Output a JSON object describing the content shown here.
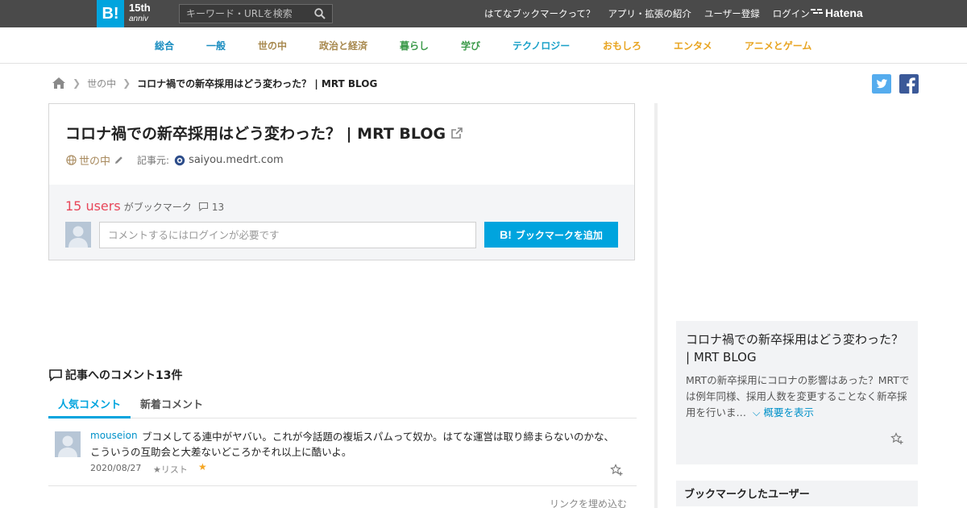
{
  "topbar": {
    "logo": "B!",
    "anniv_line1": "15th",
    "anniv_line2": "anniv",
    "search_placeholder": "キーワード・URLを検索",
    "links": [
      "はてなブックマークって？",
      "アプリ・拡張の紹介",
      "ユーザー登録",
      "ログイン"
    ],
    "brand": "Hatena"
  },
  "categories": [
    {
      "label": "総合",
      "color": "#1a8dc0"
    },
    {
      "label": "一般",
      "color": "#1a8dc0"
    },
    {
      "label": "世の中",
      "color": "#a8894f"
    },
    {
      "label": "政治と経済",
      "color": "#a8894f"
    },
    {
      "label": "暮らし",
      "color": "#3c9a4a"
    },
    {
      "label": "学び",
      "color": "#3c9a4a"
    },
    {
      "label": "テクノロジー",
      "color": "#1aa1c8"
    },
    {
      "label": "おもしろ",
      "color": "#e8a420"
    },
    {
      "label": "エンタメ",
      "color": "#e8a420"
    },
    {
      "label": "アニメとゲーム",
      "color": "#e8a420"
    }
  ],
  "breadcrumb": {
    "category": "世の中",
    "current": "コロナ禍での新卒採用はどう変わった？ | MRT BLOG"
  },
  "entry": {
    "title": "コロナ禍での新卒採用はどう変わった？ | MRT BLOG",
    "category": "世の中",
    "source_label": "記事元:",
    "source": "saiyou.medrt.com",
    "users_count": "15 users",
    "users_label": "がブックマーク",
    "comment_count": "13",
    "comment_placeholder": "コメントするにはログインが必要です",
    "add_button": "ブックマークを追加",
    "add_button_mark": "B!"
  },
  "comments": {
    "section_title": "記事へのコメント13件",
    "tabs": [
      "人気コメント",
      "新着コメント"
    ],
    "items": [
      {
        "user": "mouseion",
        "text": "ブコメしてる連中がヤバい。これが今話題の複垢スパムって奴か。はてな運営は取り締まらないのかな、こういうの互助会と大差ないどころかそれ以上に酷いよ。",
        "date": "2020/08/27",
        "list_label": "リスト",
        "star": "★"
      }
    ],
    "embed_link": "リンクを埋め込む"
  },
  "sidebar": {
    "card_title": "コロナ禍での新卒採用はどう変わった？ | MRT BLOG",
    "card_desc": "MRTの新卒採用にコロナの影響はあった？MRTでは例年同様、採用人数を変更することなく新卒採用を行いま…",
    "card_more": "概要を表示",
    "users_heading": "ブックマークしたユーザー"
  },
  "colors": {
    "brand_blue": "#00a4de",
    "users_red": "#e8475a",
    "topbar_bg": "#4a4a4a"
  }
}
